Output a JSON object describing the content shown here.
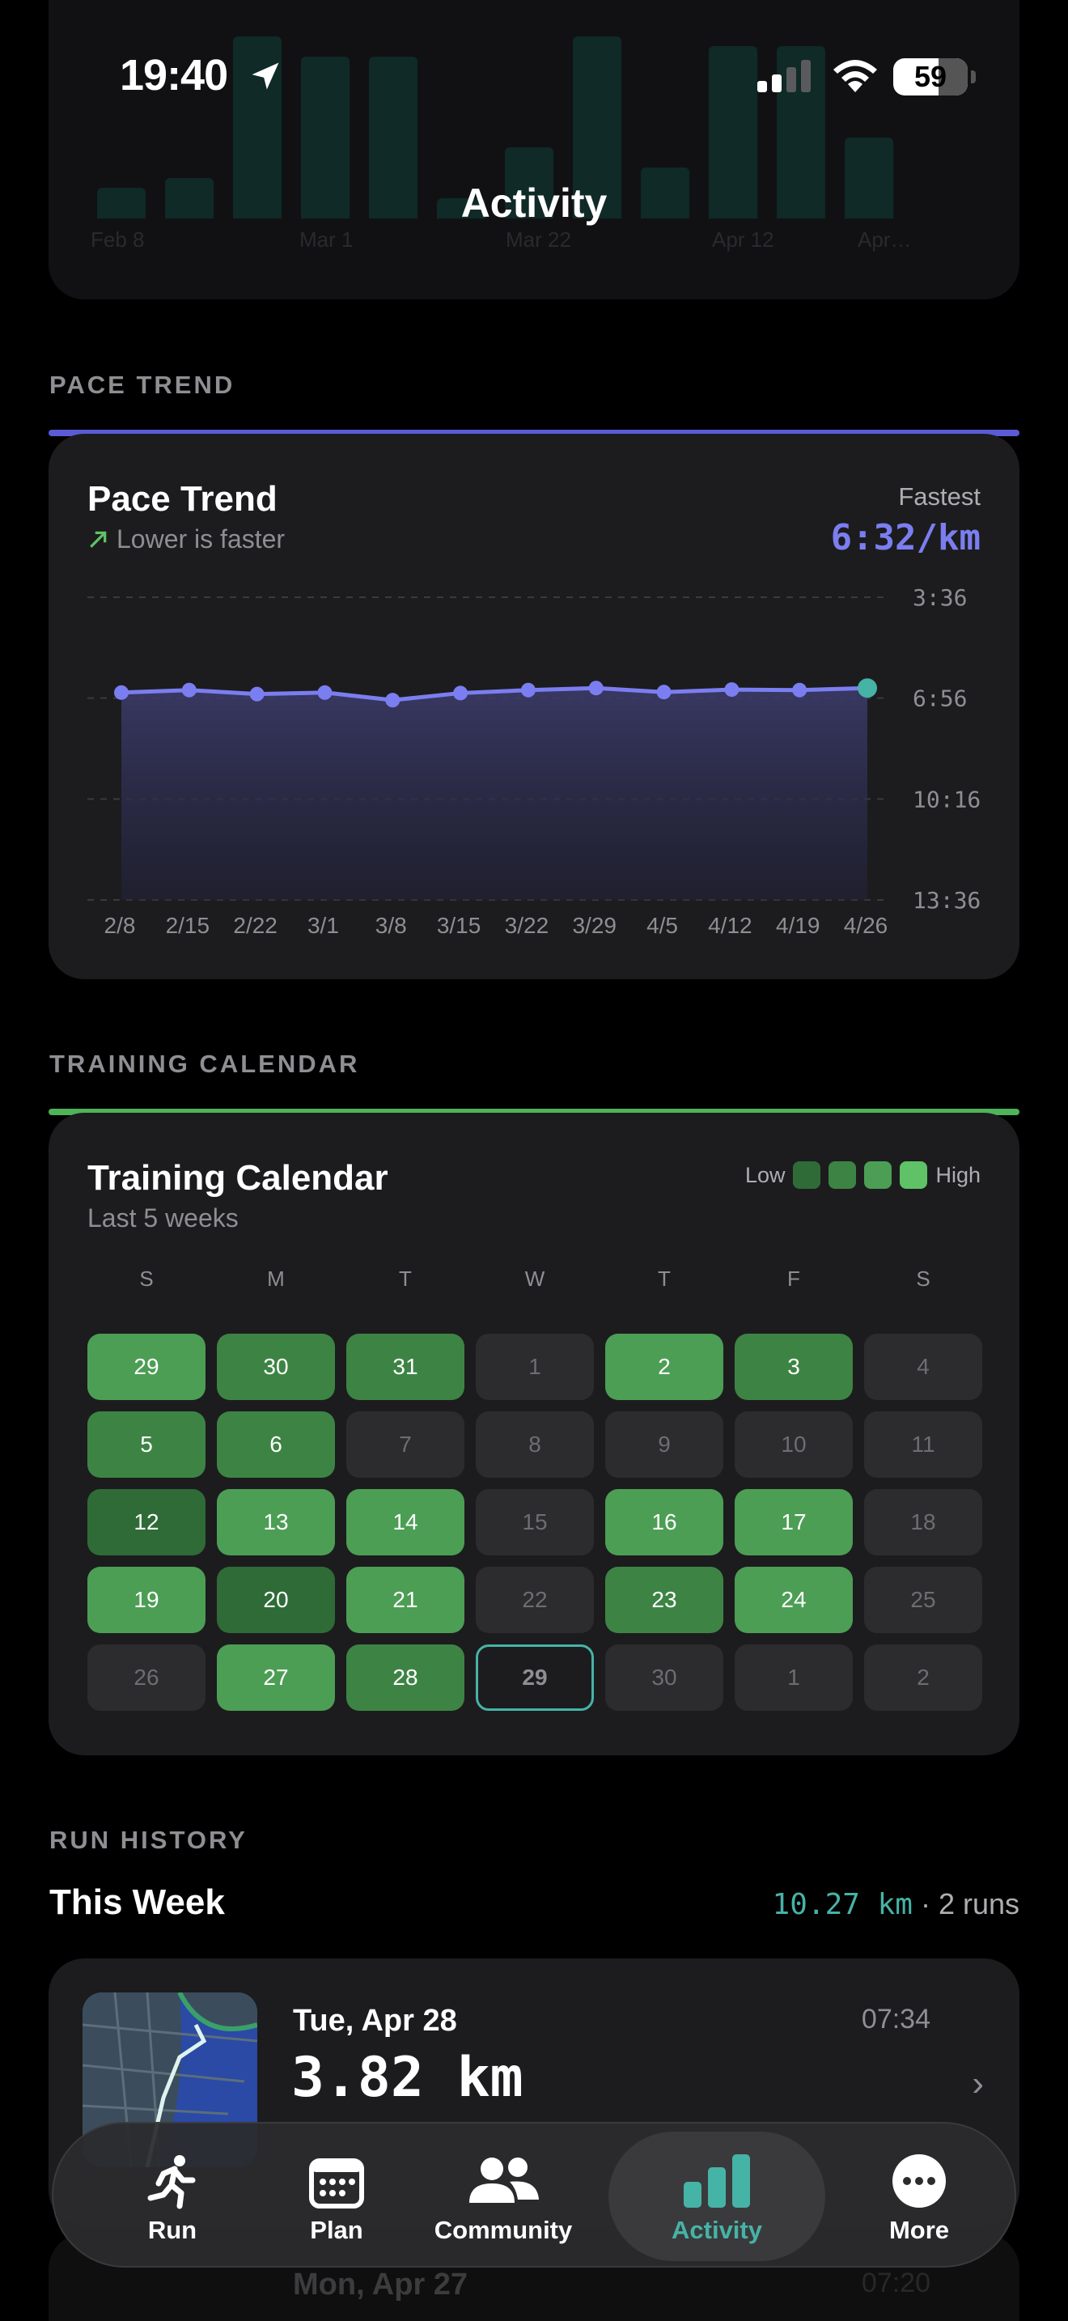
{
  "status_bar": {
    "time": "19:40",
    "battery": "59"
  },
  "header": {
    "title": "Activity"
  },
  "top_card": {
    "x_labels": [
      "Feb 8",
      "Mar 1",
      "Mar 22",
      "Apr 12",
      "Apr…"
    ],
    "bar_levels": [
      0.15,
      0.2,
      0.9,
      0.8,
      0.8,
      0.1,
      0.35,
      0.9,
      0.25,
      0.85,
      0.85,
      0.4
    ]
  },
  "pace_section": {
    "label": "PACE TREND",
    "title": "Pace Trend",
    "subtitle": "Lower is faster",
    "fastest_label": "Fastest",
    "fastest_value": "6:32/km",
    "accent_color": "#5b5bd6"
  },
  "chart_data": {
    "type": "area",
    "x": [
      "2/8",
      "2/15",
      "2/22",
      "3/1",
      "3/8",
      "3/15",
      "3/22",
      "3/29",
      "4/5",
      "4/12",
      "4/19",
      "4/26"
    ],
    "y_ticks": [
      "3:36",
      "6:56",
      "10:16",
      "13:36"
    ],
    "y_tick_seconds": [
      216,
      416,
      616,
      816
    ],
    "values_seconds": [
      405,
      400,
      408,
      405,
      420,
      406,
      400,
      396,
      404,
      399,
      400,
      396
    ],
    "ylim_seconds": [
      216,
      816
    ],
    "y_inverted": true,
    "grid": true,
    "line_color": "#7b7ef0",
    "last_point_color": "#46b3a7"
  },
  "calendar_section": {
    "label": "TRAINING CALENDAR",
    "title": "Training Calendar",
    "subtitle": "Last 5 weeks",
    "legend_low": "Low",
    "legend_high": "High",
    "legend_colors": [
      "#2f6b37",
      "#3d8444",
      "#4c9e54",
      "#5fc266"
    ],
    "accent_color": "#4fb35a",
    "weekdays": [
      "S",
      "M",
      "T",
      "W",
      "T",
      "F",
      "S"
    ],
    "weeks": [
      [
        {
          "d": "29",
          "l": 3
        },
        {
          "d": "30",
          "l": 2
        },
        {
          "d": "31",
          "l": 2
        },
        {
          "d": "1",
          "l": 0
        },
        {
          "d": "2",
          "l": 3
        },
        {
          "d": "3",
          "l": 2
        },
        {
          "d": "4",
          "l": 0
        }
      ],
      [
        {
          "d": "5",
          "l": 2
        },
        {
          "d": "6",
          "l": 2
        },
        {
          "d": "7",
          "l": 0
        },
        {
          "d": "8",
          "l": 0
        },
        {
          "d": "9",
          "l": 0
        },
        {
          "d": "10",
          "l": 0
        },
        {
          "d": "11",
          "l": 0
        }
      ],
      [
        {
          "d": "12",
          "l": 1
        },
        {
          "d": "13",
          "l": 3
        },
        {
          "d": "14",
          "l": 3
        },
        {
          "d": "15",
          "l": 0
        },
        {
          "d": "16",
          "l": 3
        },
        {
          "d": "17",
          "l": 3
        },
        {
          "d": "18",
          "l": 0
        }
      ],
      [
        {
          "d": "19",
          "l": 3
        },
        {
          "d": "20",
          "l": 1
        },
        {
          "d": "21",
          "l": 3
        },
        {
          "d": "22",
          "l": 0
        },
        {
          "d": "23",
          "l": 2
        },
        {
          "d": "24",
          "l": 3
        },
        {
          "d": "25",
          "l": 0
        }
      ],
      [
        {
          "d": "26",
          "l": 0
        },
        {
          "d": "27",
          "l": 3
        },
        {
          "d": "28",
          "l": 2
        },
        {
          "d": "29",
          "l": -1
        },
        {
          "d": "30",
          "l": 0
        },
        {
          "d": "1",
          "l": 0
        },
        {
          "d": "2",
          "l": 0
        }
      ]
    ]
  },
  "run_history": {
    "label": "RUN HISTORY",
    "week_title": "This Week",
    "week_km": "10.27 km",
    "week_runs": "· 2 runs",
    "runs": [
      {
        "date": "Tue, Apr 28",
        "time": "07:34",
        "distance": "3.82 km"
      },
      {
        "date": "Mon, Apr 27",
        "time": "07:20"
      }
    ]
  },
  "tabbar": {
    "tabs": [
      {
        "label": "Run",
        "icon": "runner-icon"
      },
      {
        "label": "Plan",
        "icon": "calendar-icon"
      },
      {
        "label": "Community",
        "icon": "people-icon"
      },
      {
        "label": "Activity",
        "icon": "bar-chart-icon",
        "active": true
      },
      {
        "label": "More",
        "icon": "more-icon"
      }
    ]
  }
}
